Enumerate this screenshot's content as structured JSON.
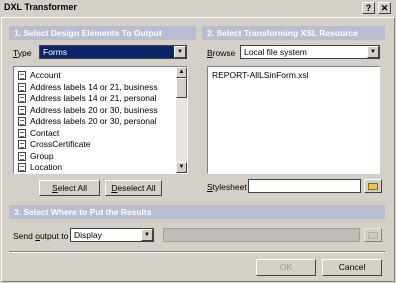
{
  "window": {
    "title": "DXL Transformer",
    "help_glyph": "?",
    "close_glyph": "✕"
  },
  "section1": {
    "title": "1. Select Design Elements To Output",
    "type_label_pre": "",
    "type_label_u": "T",
    "type_label_post": "ype",
    "type_value": "Forms",
    "items": [
      "Account",
      "Address labels 14 or 21, business",
      "Address labels 14 or 21, personal",
      "Address labels 20 or 30, business",
      "Address labels 20 or 30, personal",
      "Contact",
      "CrossCertificate",
      "Group",
      "Location"
    ],
    "select_all_pre": "",
    "select_all_u": "S",
    "select_all_post": "elect All",
    "deselect_all_pre": "",
    "deselect_all_u": "D",
    "deselect_all_post": "eselect All"
  },
  "section2": {
    "title": "2. Select Transforming XSL Resource",
    "browse_label_pre": "",
    "browse_label_u": "B",
    "browse_label_post": "rowse",
    "browse_value": "Local file system",
    "files": [
      "REPORT-AllLSinForm.xsl"
    ],
    "stylesheet_label_pre": "",
    "stylesheet_label_u": "S",
    "stylesheet_label_post": "tylesheet",
    "stylesheet_value": ""
  },
  "section3": {
    "title": "3. Select Where to Put the Results",
    "send_label_pre": "Send ",
    "send_label_u": "o",
    "send_label_post": "utput to",
    "send_value": "Display",
    "output_path": ""
  },
  "footer": {
    "ok_label": "OK",
    "cancel_label": "Cancel"
  }
}
